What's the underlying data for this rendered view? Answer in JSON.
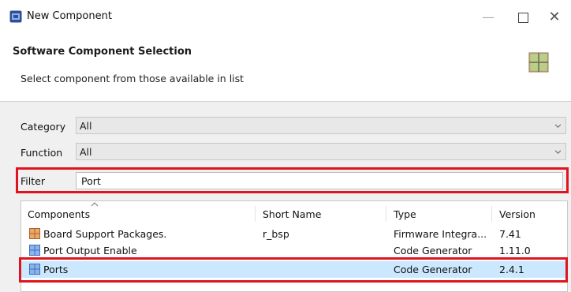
{
  "window": {
    "title": "New Component"
  },
  "header": {
    "title": "Software Component Selection",
    "subtitle": "Select component from those available in list"
  },
  "form": {
    "category": {
      "label": "Category",
      "value": "All"
    },
    "function": {
      "label": "Function",
      "value": "All"
    },
    "filter": {
      "label": "Filter",
      "value": "Port"
    }
  },
  "table": {
    "columns": [
      "Components",
      "Short Name",
      "Type",
      "Version"
    ],
    "rows": [
      {
        "name": "Board Support Packages.",
        "short_name": "r_bsp",
        "type": "Firmware Integra...",
        "version": "7.41",
        "icon": "bsp-package-icon"
      },
      {
        "name": "Port Output Enable",
        "short_name": "",
        "type": "Code Generator",
        "version": "1.11.0",
        "icon": "code-generator-icon"
      },
      {
        "name": "Ports",
        "short_name": "",
        "type": "Code Generator",
        "version": "2.4.1",
        "icon": "code-generator-icon",
        "selected": true
      }
    ]
  },
  "colors": {
    "highlight": "#e0141e",
    "selection": "#cce8ff",
    "bsp_icon": "#c8763a",
    "codegen_icon": "#3a6fc0"
  }
}
